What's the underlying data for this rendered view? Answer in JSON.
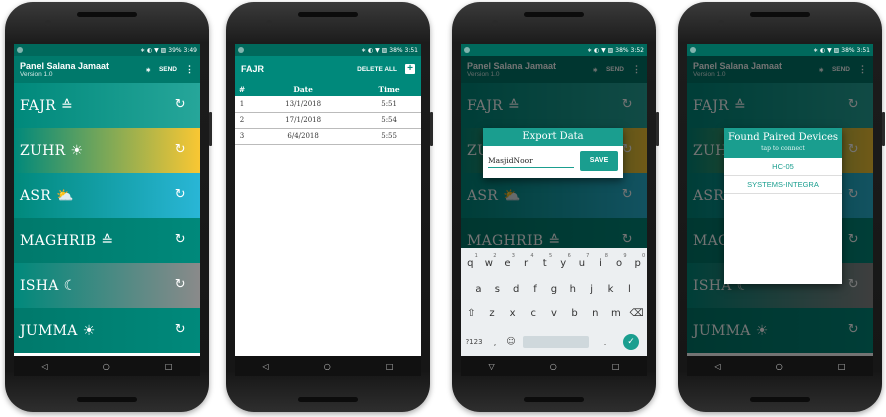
{
  "status": {
    "s1": {
      "icons": "∗ ◐ ▼ ▨",
      "battery": "39%",
      "time": "3:49"
    },
    "s2": {
      "icons": "∗ ◐ ▼ ▨",
      "battery": "38%",
      "time": "3:51"
    },
    "s3": {
      "icons": "∗ ◐ ▼ ▨",
      "battery": "38%",
      "time": "3:52"
    },
    "s4": {
      "icons": "∗ ◐ ▼ ▨",
      "battery": "38%",
      "time": "3:51"
    }
  },
  "app": {
    "title": "Panel Salana Jamaat",
    "version": "Version 1.0",
    "send": "SEND",
    "bluetooth": "∗",
    "more": "⋮"
  },
  "prayers": [
    {
      "name": "FAJR",
      "icon": "≙",
      "bg": "linear-gradient(90deg,#00897b,#26a69a)"
    },
    {
      "name": "ZUHR",
      "icon": "☀",
      "bg": "linear-gradient(90deg,#00897b,#f9c733)"
    },
    {
      "name": "ASR",
      "icon": "⛅",
      "bg": "linear-gradient(90deg,#00897b,#29b6d6)"
    },
    {
      "name": "MAGHRIB",
      "icon": "≙",
      "bg": "linear-gradient(90deg,#00796b,#00897b)"
    },
    {
      "name": "ISHA",
      "icon": "☾",
      "bg": "linear-gradient(90deg,#00897b,#8a8a8a)"
    },
    {
      "name": "JUMMA",
      "icon": "☀",
      "bg": "linear-gradient(90deg,#00796b,#00897b)"
    }
  ],
  "refresh_icon": "↻",
  "log": {
    "title": "FAJR",
    "delete_all": "DELETE ALL",
    "add": "+",
    "headers": [
      "#",
      "Date",
      "Time"
    ],
    "rows": [
      [
        "1",
        "13/1/2018",
        "5:51"
      ],
      [
        "2",
        "17/1/2018",
        "5:54"
      ],
      [
        "3",
        "6/4/2018",
        "5:55"
      ]
    ]
  },
  "export": {
    "title": "Export Data",
    "value": "MasjidNoor",
    "save": "SAVE"
  },
  "keyboard": {
    "row1": [
      "q",
      "w",
      "e",
      "r",
      "t",
      "y",
      "u",
      "i",
      "o",
      "p"
    ],
    "row1_sup": [
      "1",
      "2",
      "3",
      "4",
      "5",
      "6",
      "7",
      "8",
      "9",
      "0"
    ],
    "row2": [
      "a",
      "s",
      "d",
      "f",
      "g",
      "h",
      "j",
      "k",
      "l"
    ],
    "row3": [
      "⇧",
      "z",
      "x",
      "c",
      "v",
      "b",
      "n",
      "m",
      "⌫"
    ],
    "row4": [
      "?123",
      ",",
      "☺",
      ".",
      "✓"
    ]
  },
  "devices": {
    "title": "Found Paired Devices",
    "subtitle": "tap to connect",
    "items": [
      "HC-05",
      "SYSTEMS-INTEGRA"
    ]
  },
  "nav": {
    "back": "◁",
    "home": "○",
    "recents": "□",
    "down": "▽"
  }
}
